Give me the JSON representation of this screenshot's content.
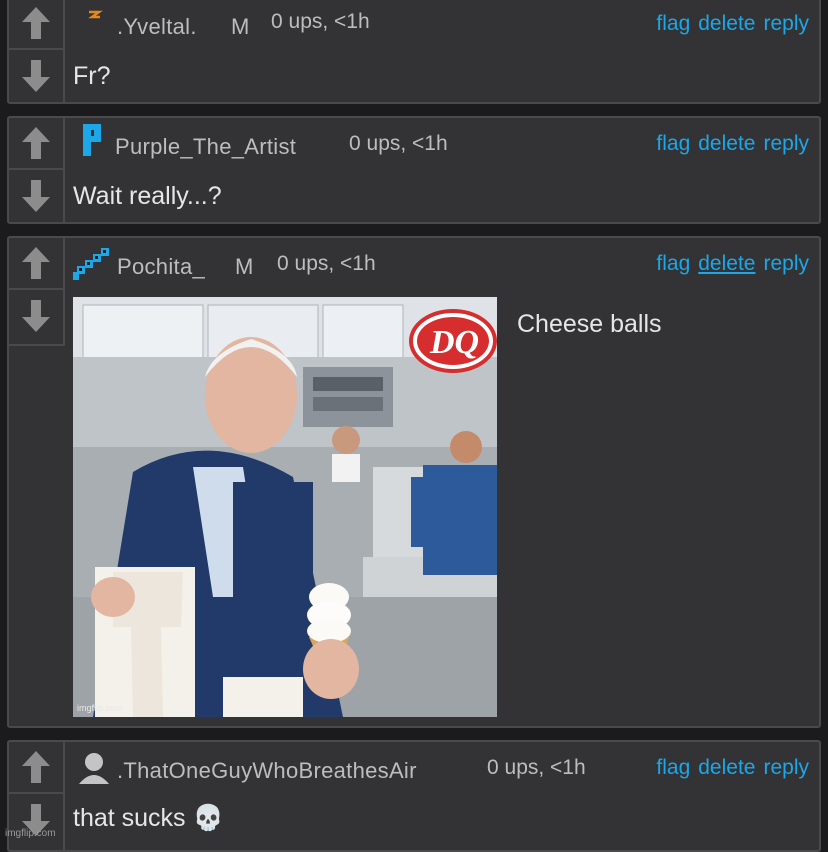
{
  "comments": [
    {
      "username": ".Yveltal.",
      "badge": "M",
      "meta": "0 ups, <1h",
      "actions": {
        "flag": "flag",
        "delete": "delete",
        "reply": "reply"
      },
      "text": "Fr?",
      "avatar_icon": "lightning-icon"
    },
    {
      "username": "Purple_The_Artist",
      "badge": "",
      "meta": "0 ups, <1h",
      "actions": {
        "flag": "flag",
        "delete": "delete",
        "reply": "reply"
      },
      "text": "Wait really...?",
      "avatar_icon": "letter-p-icon"
    },
    {
      "username": "Pochita_",
      "badge": "M",
      "meta": "0 ups, <1h",
      "actions": {
        "flag": "flag",
        "delete": "delete",
        "reply": "reply"
      },
      "text": "Cheese balls",
      "avatar_icon": "pixel-diagonal-icon",
      "image": {
        "sign_text": "DQ",
        "watermark": "imgflip.com"
      }
    },
    {
      "username": ".ThatOneGuyWhoBreathesAir",
      "badge": "",
      "meta": "0 ups, <1h",
      "actions": {
        "flag": "flag",
        "delete": "delete",
        "reply": "reply"
      },
      "text": "that sucks",
      "emoji": "💀",
      "avatar_icon": "default-user-icon"
    }
  ],
  "page_watermark": "imgflip.com",
  "colors": {
    "link": "#1ba7e8",
    "panel": "#333336",
    "border": "#4a4a4d",
    "background": "#1b1b1d"
  }
}
